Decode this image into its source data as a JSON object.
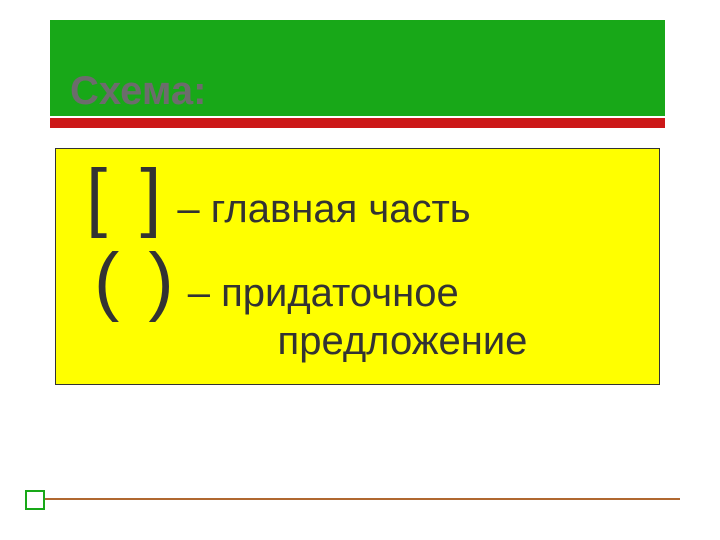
{
  "title": "Схема:",
  "legend": {
    "square_brackets": "[     ]",
    "parentheses": "(      )",
    "main_part_label": "– главная часть",
    "subordinate_label_1": "– придаточное",
    "subordinate_label_2": "предложение"
  }
}
